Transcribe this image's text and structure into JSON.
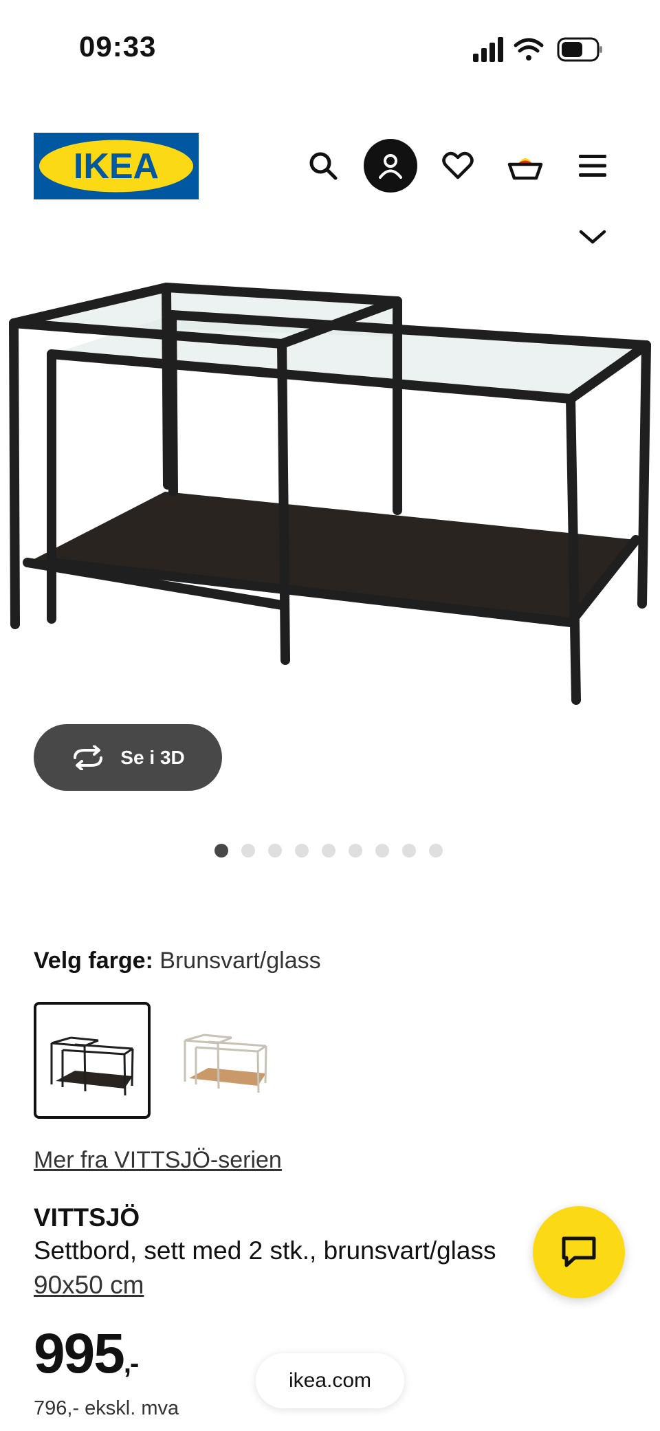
{
  "status_bar": {
    "time": "09:33"
  },
  "header": {
    "logo_text": "IKEA",
    "icons": [
      "search-icon",
      "profile-icon",
      "heart-icon",
      "cart-icon",
      "menu-icon",
      "chevron-down-icon"
    ]
  },
  "gallery": {
    "button_3d_label": "Se i 3D",
    "dot_count": 9,
    "active_dot": 1
  },
  "color_select": {
    "label": "Velg farge:",
    "value": "Brunsvart/glass",
    "swatches": [
      {
        "name": "Brunsvart/glass",
        "selected": true
      },
      {
        "name": "Hvit/glass",
        "selected": false
      }
    ]
  },
  "series_link": "Mer fra VITTSJÖ-serien",
  "product": {
    "name": "VITTSJÖ",
    "description": "Settbord, sett med 2 stk., brunsvart/glass",
    "size": "90x50 cm",
    "price": "995",
    "price_suffix": ",-",
    "price_ex_vat": "796,- ekskl. mva"
  },
  "browser": {
    "url": "ikea.com"
  },
  "colors": {
    "ikea_blue": "#0058a3",
    "ikea_yellow": "#fbd914",
    "dark_button": "#484848"
  }
}
